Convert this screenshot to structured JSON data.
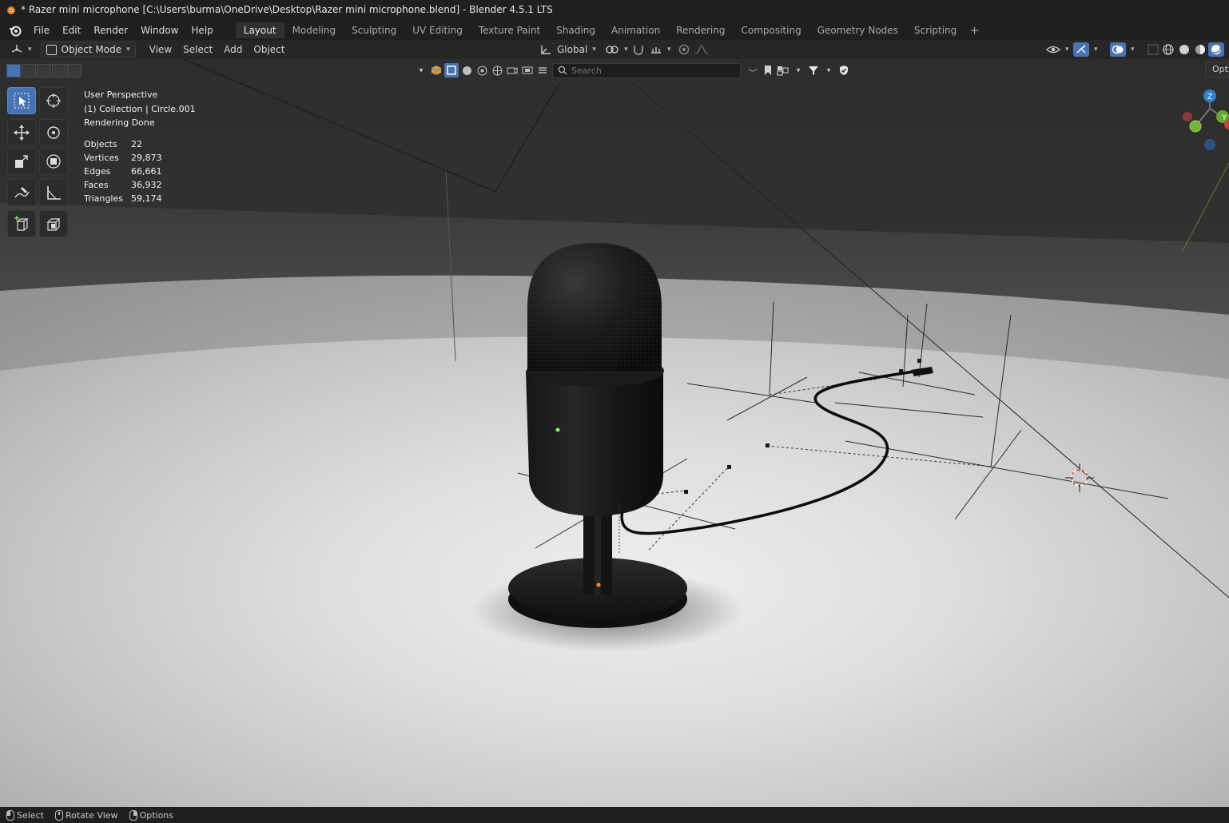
{
  "window": {
    "title": "* Razer mini microphone [C:\\Users\\burma\\OneDrive\\Desktop\\Razer mini microphone.blend] - Blender 4.5.1 LTS"
  },
  "menu": {
    "items": [
      "File",
      "Edit",
      "Render",
      "Window",
      "Help"
    ]
  },
  "workspaces": {
    "tabs": [
      "Layout",
      "Modeling",
      "Sculpting",
      "UV Editing",
      "Texture Paint",
      "Shading",
      "Animation",
      "Rendering",
      "Compositing",
      "Geometry Nodes",
      "Scripting"
    ],
    "active": "Layout",
    "add": "+"
  },
  "header": {
    "mode": "Object Mode",
    "view": "View",
    "select": "Select",
    "add": "Add",
    "object": "Object",
    "orientation": "Global"
  },
  "viewport": {
    "perspective": "User Perspective",
    "collection": "(1) Collection | Circle.001",
    "status": "Rendering Done",
    "stats": [
      {
        "label": "Objects",
        "value": "22"
      },
      {
        "label": "Vertices",
        "value": "29,873"
      },
      {
        "label": "Edges",
        "value": "66,661"
      },
      {
        "label": "Faces",
        "value": "36,932"
      },
      {
        "label": "Triangles",
        "value": "59,174"
      }
    ],
    "search_placeholder": "Search",
    "options_label": "Opt",
    "gizmo": {
      "z": "Z",
      "y": "Y"
    }
  },
  "statusbar": {
    "select": "Select",
    "rotate": "Rotate View",
    "options": "Options"
  },
  "colors": {
    "accent": "#4772b3",
    "led_green": "#7dff5a",
    "led_orange": "#ff8a30"
  }
}
